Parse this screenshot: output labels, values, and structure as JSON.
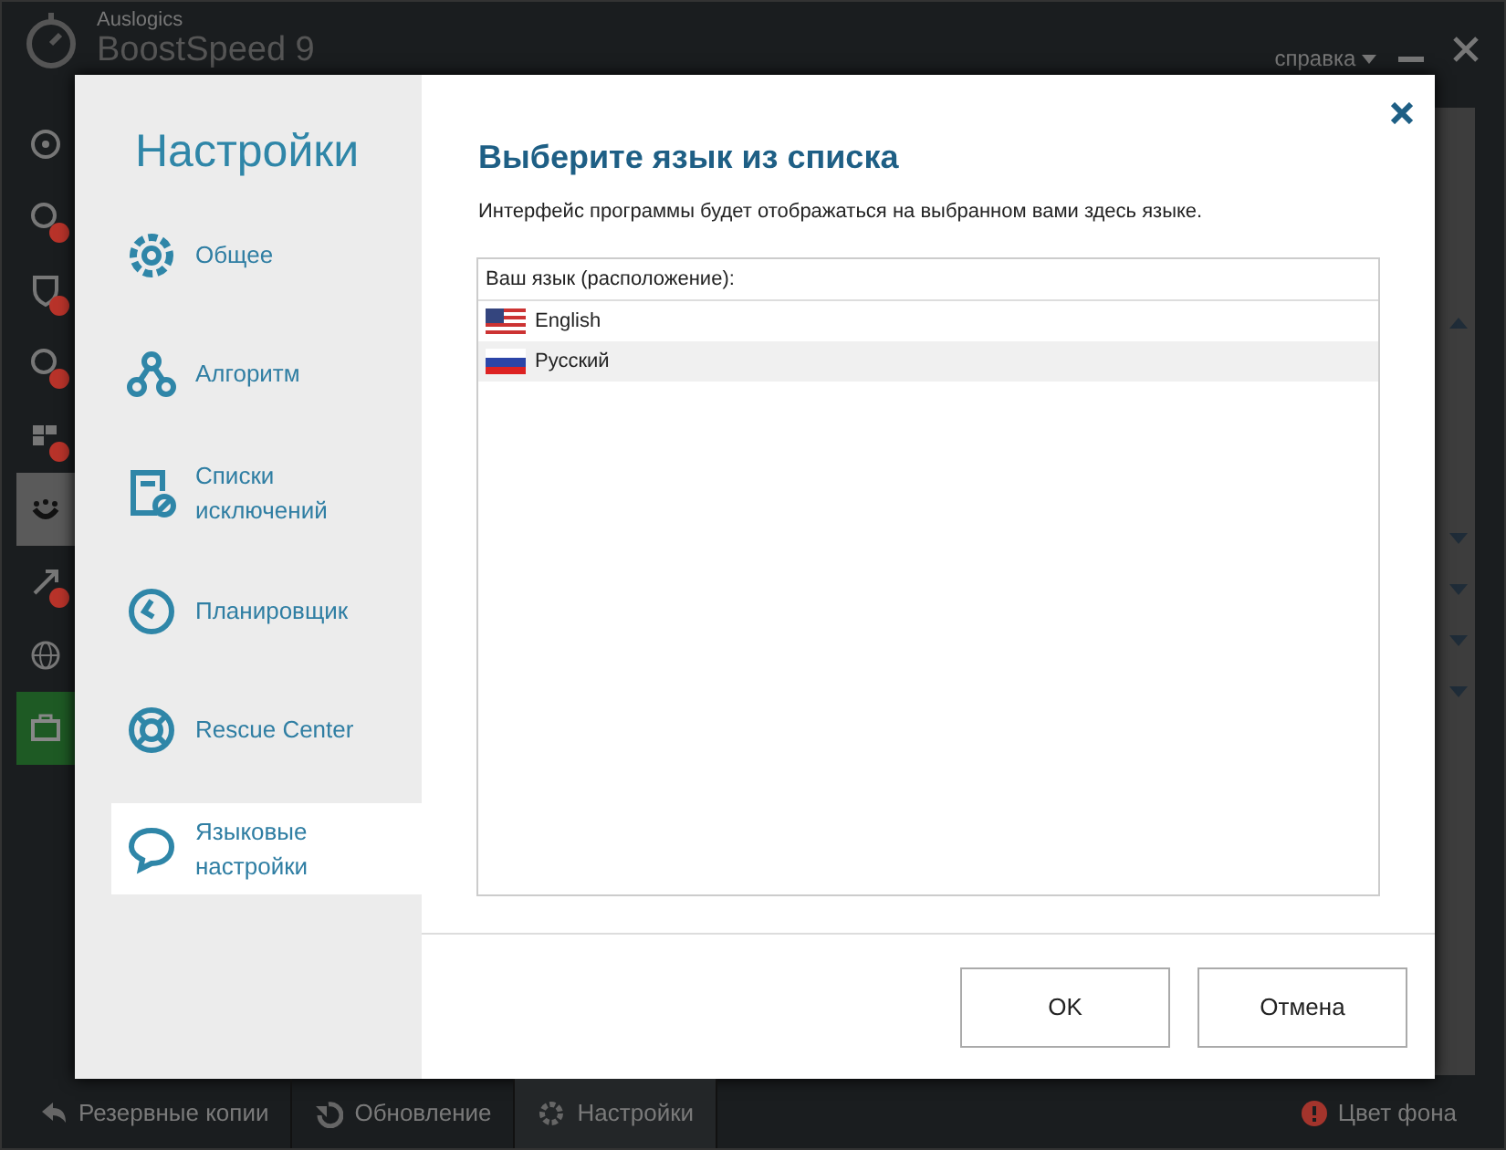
{
  "app": {
    "vendor": "Auslogics",
    "title": "BoostSpeed 9",
    "help_menu": "справка"
  },
  "rail": [
    {
      "selected": false,
      "alert": false
    },
    {
      "selected": false,
      "alert": true
    },
    {
      "selected": false,
      "alert": true
    },
    {
      "selected": false,
      "alert": true
    },
    {
      "selected": false,
      "alert": true
    },
    {
      "selected": true,
      "alert": false
    },
    {
      "selected": false,
      "alert": true
    },
    {
      "selected": false,
      "alert": false
    },
    {
      "selected": false,
      "alert": false,
      "kind": "tools"
    }
  ],
  "background_sections": [
    {
      "expanded": true
    },
    {
      "expanded": false
    },
    {
      "expanded": false
    },
    {
      "expanded": false
    },
    {
      "expanded": false
    }
  ],
  "dialog": {
    "title": "Настройки",
    "nav": [
      {
        "label": "Общее",
        "selected": false
      },
      {
        "label": "Алгоритм",
        "selected": false
      },
      {
        "label": "Списки исключений",
        "selected": false
      },
      {
        "label": "Планировщик",
        "selected": false
      },
      {
        "label": "Rescue Center",
        "selected": false
      },
      {
        "label": "Языковые настройки",
        "selected": true
      }
    ],
    "heading": "Выберите язык из списка",
    "description": "Интерфейс программы будет отображаться на выбранном вами здесь языке.",
    "list_header": "Ваш язык (расположение):",
    "languages": [
      {
        "label": "English",
        "kind": "us",
        "selected": false
      },
      {
        "label": "Русский",
        "kind": "ru",
        "selected": true
      }
    ],
    "buttons": [
      "OK",
      "Отмена"
    ]
  },
  "bottom_bar": [
    {
      "label": "Резервные копии",
      "selected": false
    },
    {
      "label": "Обновление",
      "selected": false
    },
    {
      "label": "Настройки",
      "selected": true
    }
  ],
  "background_color_link": "Цвет фона"
}
